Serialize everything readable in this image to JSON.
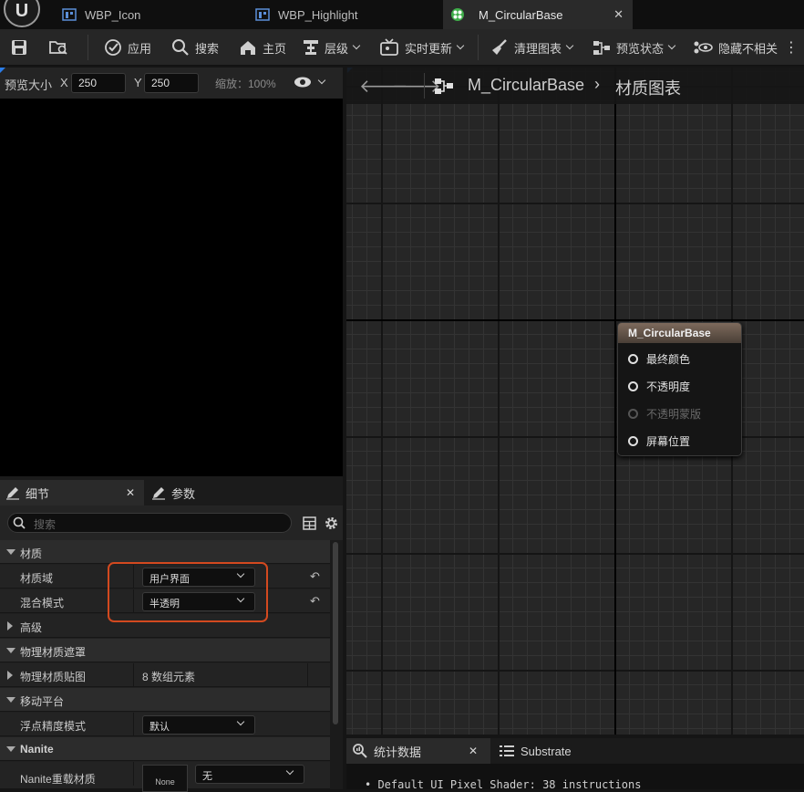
{
  "tabs": [
    {
      "label": "WBP_Icon"
    },
    {
      "label": "WBP_Highlight"
    },
    {
      "label": "M_CircularBase",
      "active": true
    }
  ],
  "toolbar": {
    "apply": "应用",
    "search": "搜索",
    "home": "主页",
    "hierarchy": "层级",
    "live_update": "实时更新",
    "clean_graph": "清理图表",
    "preview_state": "预览状态",
    "hide_unrelated": "隐藏不相关"
  },
  "preview": {
    "size_label": "预览大小",
    "x_label": "X",
    "x_value": "250",
    "y_label": "Y",
    "y_value": "250",
    "zoom": "缩放：100%"
  },
  "details": {
    "tab_details": "细节",
    "tab_params": "参数",
    "search_placeholder": "搜索"
  },
  "props": {
    "material_cat": "材质",
    "domain_label": "材质域",
    "domain_value": "用户界面",
    "blend_label": "混合模式",
    "blend_value": "半透明",
    "advanced_cat": "高级",
    "phys_mask_cat": "物理材质遮罩",
    "phys_map_label": "物理材质贴图",
    "phys_map_value": "8 数组元素",
    "mobile_cat": "移动平台",
    "float_label": "浮点精度模式",
    "float_value": "默认",
    "nanite_cat": "Nanite",
    "nanite_label": "Nanite重载材质",
    "nanite_thumb": "None",
    "nanite_value": "无"
  },
  "graph": {
    "breadcrumb_asset": "M_CircularBase",
    "breadcrumb_section": "材质图表"
  },
  "node": {
    "title": "M_CircularBase",
    "pins": [
      {
        "label": "最终颜色",
        "enabled": true
      },
      {
        "label": "不透明度",
        "enabled": true
      },
      {
        "label": "不透明蒙版",
        "enabled": false
      },
      {
        "label": "屏幕位置",
        "enabled": true
      }
    ]
  },
  "bottom": {
    "tab_stats": "统计数据",
    "tab_substrate": "Substrate",
    "stats_line": "• Default UI Pixel Shader: 38 instructions"
  },
  "colors": {
    "highlight": "#d3491f",
    "accent": "#2b7de9"
  }
}
